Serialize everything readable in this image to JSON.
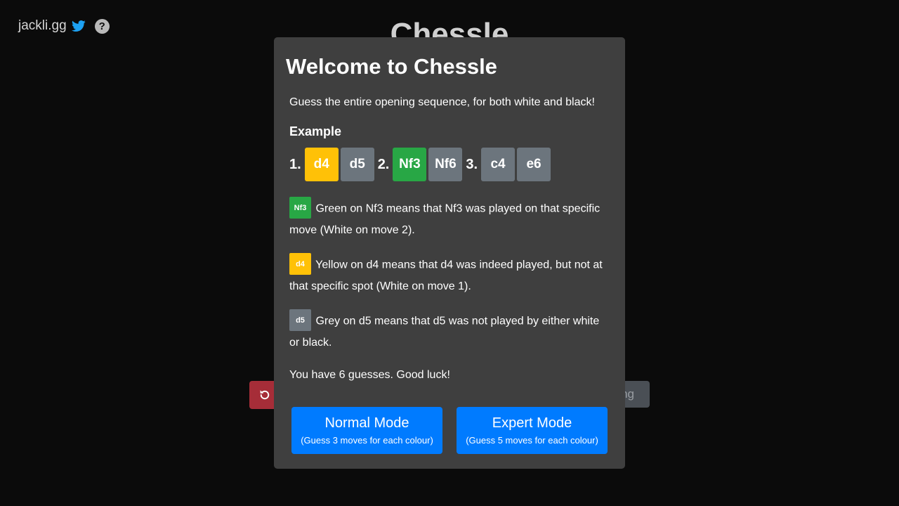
{
  "header": {
    "brand": "jackli.gg",
    "help_glyph": "?"
  },
  "background": {
    "title": "Chessle",
    "right_button_label": "ng"
  },
  "modal": {
    "title": "Welcome to Chessle",
    "intro": "Guess the entire opening sequence, for both white and black!",
    "example_heading": "Example",
    "example_moves": [
      {
        "number": "1.",
        "white": {
          "move": "d4",
          "status": "yellow"
        },
        "black": {
          "move": "d5",
          "status": "grey"
        }
      },
      {
        "number": "2.",
        "white": {
          "move": "Nf3",
          "status": "green"
        },
        "black": {
          "move": "Nf6",
          "status": "grey"
        }
      },
      {
        "number": "3.",
        "white": {
          "move": "c4",
          "status": "grey"
        },
        "black": {
          "move": "e6",
          "status": "grey"
        }
      }
    ],
    "explanations": {
      "green": {
        "tile": "Nf3",
        "text": "Green on Nf3 means that Nf3 was played on that specific move (White on move 2)."
      },
      "yellow": {
        "tile": "d4",
        "text": "Yellow on d4 means that d4 was indeed played, but not at that specific spot (White on move 1)."
      },
      "grey": {
        "tile": "d5",
        "text": "Grey on d5 means that d5 was not played by either white or black."
      }
    },
    "good_luck": "You have 6 guesses. Good luck!",
    "normal_mode": {
      "label": "Normal Mode",
      "sub": "(Guess 3 moves for each colour)"
    },
    "expert_mode": {
      "label": "Expert Mode",
      "sub": "(Guess 5 moves for each colour)"
    }
  },
  "colors": {
    "green": "#28a745",
    "yellow": "#ffc107",
    "grey": "#6c757d",
    "primary": "#007bff",
    "danger": "#a62d38",
    "twitter": "#1da1f2"
  },
  "icons": {
    "twitter": "twitter-icon",
    "help": "question-circle-icon",
    "reset": "undo-icon"
  }
}
